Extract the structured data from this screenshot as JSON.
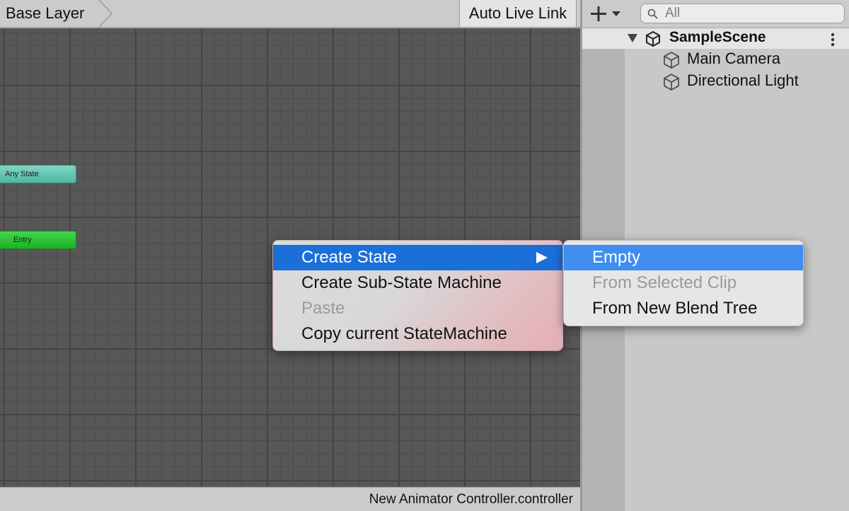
{
  "animator": {
    "breadcrumb": "Base Layer",
    "auto_live_link": "Auto Live Link",
    "nodes": {
      "any_state": "Any State",
      "entry": "Entry"
    },
    "status": "New Animator Controller.controller"
  },
  "hierarchy": {
    "search_placeholder": "All",
    "scene": "SampleScene",
    "items": [
      "Main Camera",
      "Directional Light"
    ]
  },
  "context_menu": {
    "items": [
      {
        "label": "Create State",
        "state": "highlighted",
        "has_submenu": true
      },
      {
        "label": "Create Sub-State Machine",
        "state": "enabled"
      },
      {
        "label": "Paste",
        "state": "disabled"
      },
      {
        "label": "Copy current StateMachine",
        "state": "enabled"
      }
    ]
  },
  "submenu": {
    "items": [
      {
        "label": "Empty",
        "state": "highlighted"
      },
      {
        "label": "From Selected Clip",
        "state": "disabled"
      },
      {
        "label": "From New Blend Tree",
        "state": "enabled"
      }
    ]
  },
  "colors": {
    "menu_highlight": "#1b6fd8",
    "submenu_highlight": "#3f8ef0",
    "any_state_node": "#5ec5b2",
    "entry_node": "#2fc939"
  }
}
